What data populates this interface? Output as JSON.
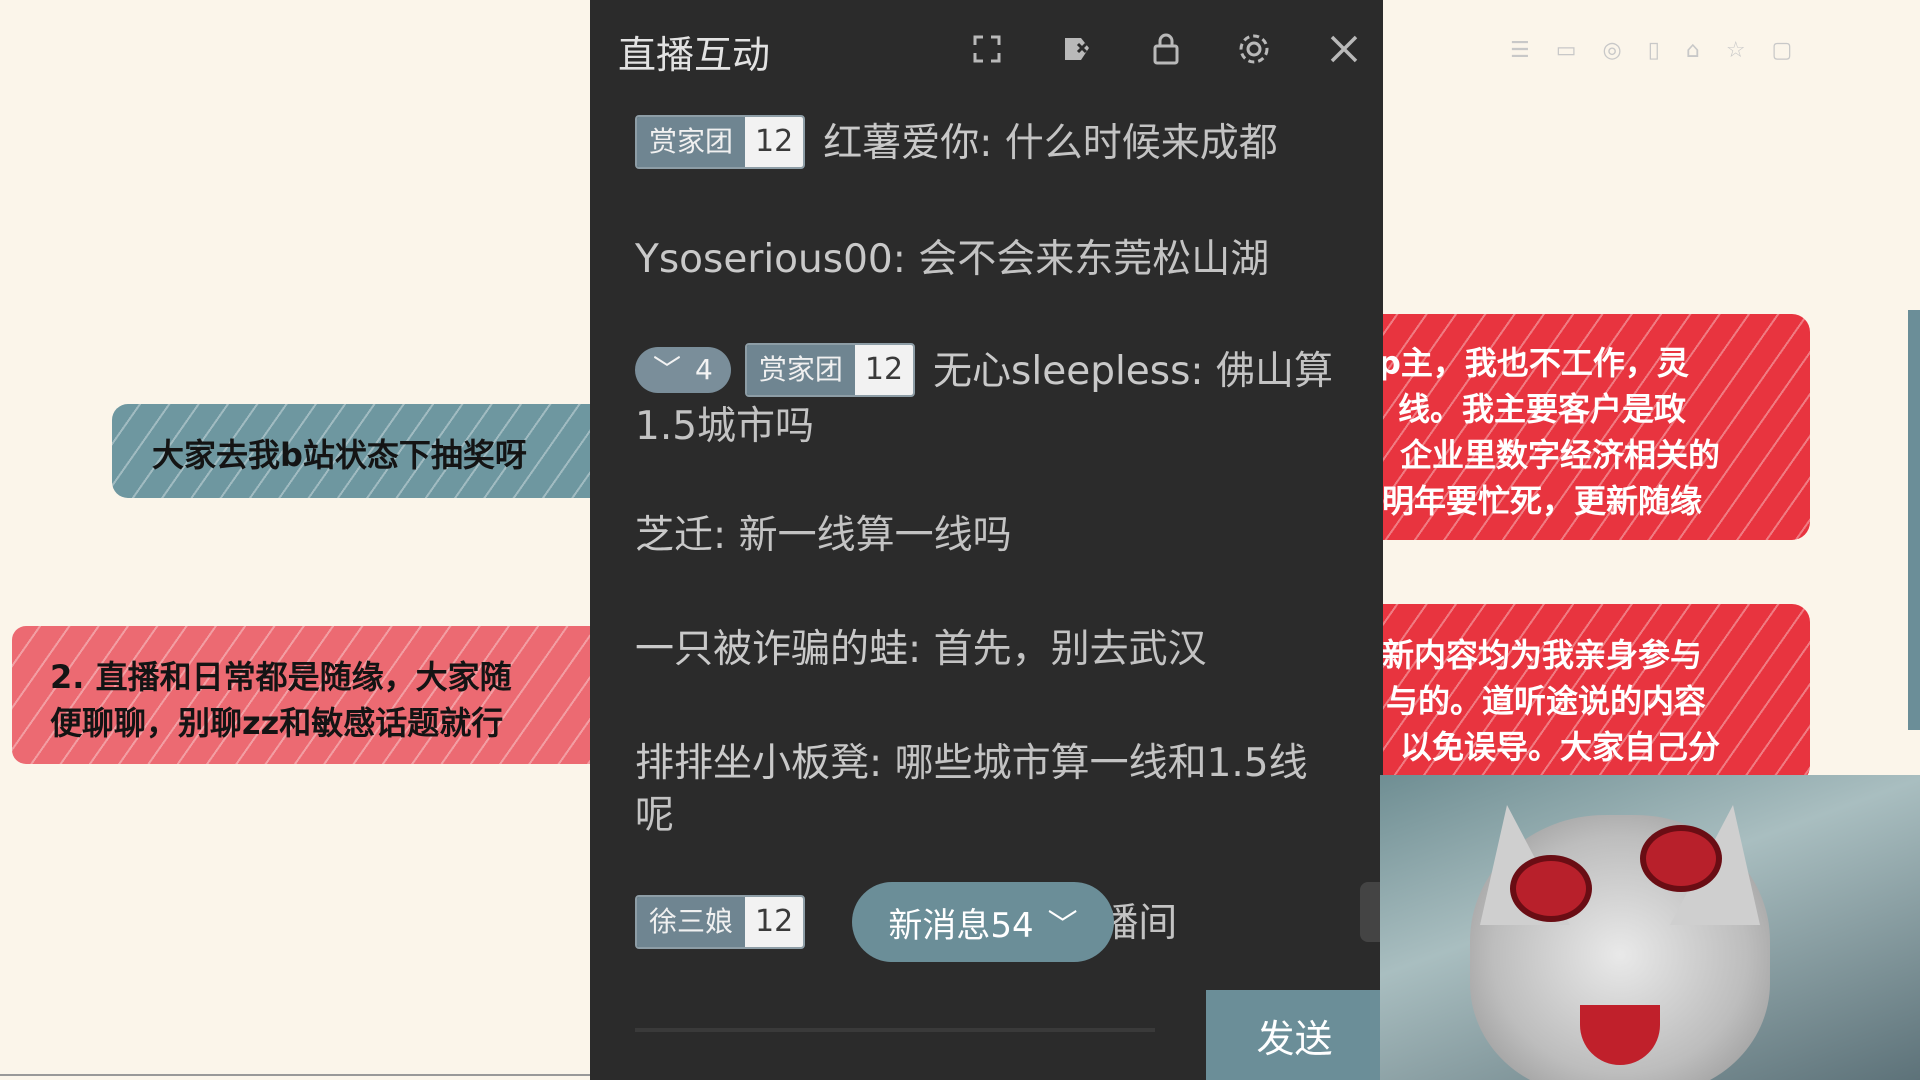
{
  "background_notes": {
    "teal_note": "大家去我b站状态下抽奖呀",
    "pink_note_line1": "2. 直播和日常都是随缘，大家随",
    "pink_note_line2": "便聊聊，别聊zz和敏感话题就行",
    "red_note_1": [
      "p主，我也不工作，灵",
      "线。我主要客户是政",
      "企业里数字经济相关的",
      "明年要忙死，更新随缘"
    ],
    "red_note_2": [
      "新内容均为我亲身参与",
      "与的。道听途说的内容",
      "以免误导。大家自己分"
    ]
  },
  "panel": {
    "title": "直播互动",
    "icons": [
      "expand-icon",
      "clean-icon",
      "lock-icon",
      "gear-icon",
      "close-icon"
    ],
    "messages": [
      {
        "badge_name": "赏家团",
        "badge_level": "12",
        "user": "红薯爱你",
        "text": "什么时候来成都"
      },
      {
        "user": "Ysoserious00",
        "text": "会不会来东莞松山湖"
      },
      {
        "heart_count": "4",
        "badge_name": "赏家团",
        "badge_level": "12",
        "user": "无心sleepless",
        "text": "佛山算1.5城市吗"
      },
      {
        "user": "芝迁",
        "text": "新一线算一线吗"
      },
      {
        "user": "一只被诈骗的蛙",
        "text": "首先，别去武汉"
      },
      {
        "user": "排排坐小板凳",
        "text": "哪些城市算一线和1.5线呢"
      },
      {
        "badge_name": "徐三娘",
        "badge_level": "12",
        "text": "播间"
      }
    ],
    "new_messages": "新消息54",
    "send_label": "发送"
  },
  "colors": {
    "panel_bg": "#2b2b2b",
    "accent": "#6b8e98",
    "note_teal": "#6e97a0",
    "note_red": "#e8343f",
    "note_pink": "#ec6a72"
  }
}
